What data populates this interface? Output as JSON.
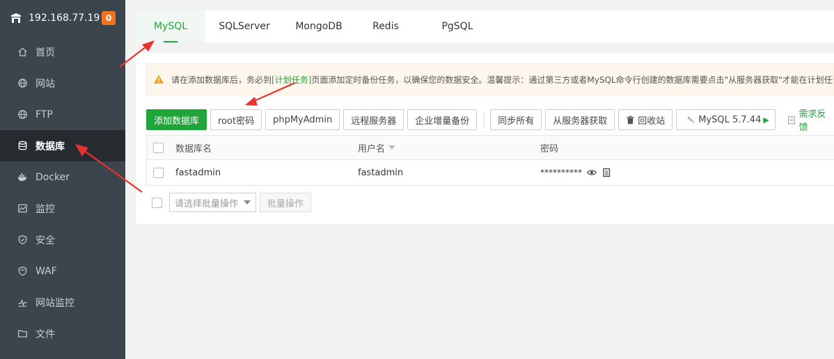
{
  "sidebar": {
    "server_ip": "192.168.77.19",
    "badge_count": "0",
    "items": [
      {
        "label": "首页",
        "icon": "home-icon"
      },
      {
        "label": "网站",
        "icon": "globe-icon"
      },
      {
        "label": "FTP",
        "icon": "ftp-globe-icon"
      },
      {
        "label": "数据库",
        "icon": "database-icon",
        "active": true
      },
      {
        "label": "Docker",
        "icon": "docker-icon"
      },
      {
        "label": "监控",
        "icon": "monitor-icon"
      },
      {
        "label": "安全",
        "icon": "shield-icon"
      },
      {
        "label": "WAF",
        "icon": "waf-shield-icon"
      },
      {
        "label": "网站监控",
        "icon": "pulse-icon"
      },
      {
        "label": "文件",
        "icon": "folder-icon"
      }
    ]
  },
  "tabs": [
    "MySQL",
    "SQLServer",
    "MongoDB",
    "Redis",
    "PgSQL"
  ],
  "active_tab": "MySQL",
  "notice": {
    "prefix": "请在添加数据库后，务必到",
    "link": "[计划任务]",
    "suffix": "页面添加定时备份任务，以确保您的数据安全。温馨提示：通过第三方或者MySQL命令行创建的数据库需要点击\"从服务器获取\"才能在计划任务"
  },
  "toolbar": {
    "add_db": "添加数据库",
    "root_pwd": "root密码",
    "phpmyadmin": "phpMyAdmin",
    "remote_server": "远程服务器",
    "enterprise_backup": "企业增量备份",
    "sync_all": "同步所有",
    "fetch_from_server": "从服务器获取",
    "recycle_bin": "回收站",
    "mysql_version": "MySQL 5.7.44",
    "feedback": "需求反馈"
  },
  "table": {
    "headers": {
      "name": "数据库名",
      "user": "用户名",
      "password": "密码"
    },
    "rows": [
      {
        "name": "fastadmin",
        "user": "fastadmin",
        "password": "**********"
      }
    ]
  },
  "batch": {
    "select_placeholder": "请选择批量操作",
    "button": "批量操作"
  },
  "colors": {
    "accent": "#20a53a",
    "sidebar_bg": "#3c444d",
    "sidebar_active": "#262b30",
    "badge": "#f0741f",
    "arrow": "#e8322e"
  }
}
